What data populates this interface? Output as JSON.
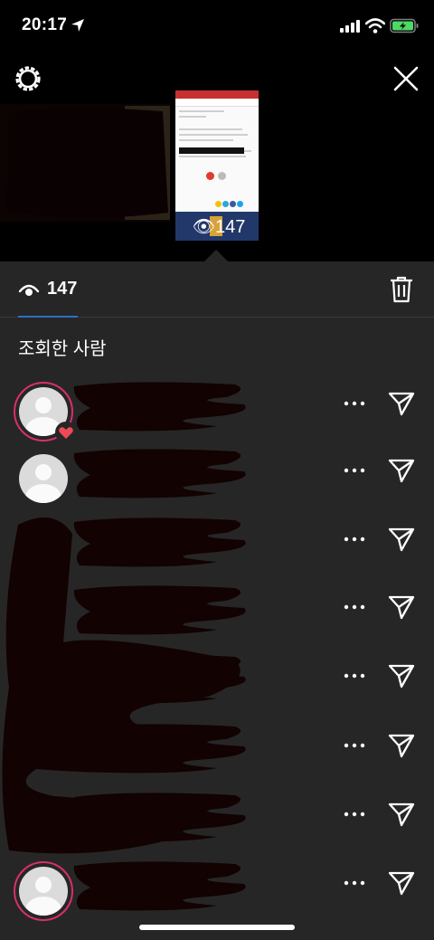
{
  "status_bar": {
    "time": "20:17"
  },
  "story": {
    "thumbnail_view_count": "147"
  },
  "viewers_panel": {
    "view_count": "147",
    "section_title": "조회한 사람"
  },
  "colors": {
    "background": "#262626",
    "top_background": "#000000",
    "accent_ring": "#d72f6d",
    "heart": "#ed4956",
    "tab_underline": "#2f6fbf"
  },
  "viewers": [
    {
      "avatar": "default",
      "story_ring": true,
      "liked": true
    },
    {
      "avatar": "default",
      "story_ring": false,
      "liked": false
    },
    {
      "avatar": "photo",
      "story_ring": false,
      "liked": false
    },
    {
      "avatar": "hidden",
      "story_ring": false,
      "liked": false
    },
    {
      "avatar": "hidden",
      "story_ring": false,
      "liked": false
    },
    {
      "avatar": "hidden",
      "story_ring": false,
      "liked": false
    },
    {
      "avatar": "hidden",
      "story_ring": false,
      "liked": false
    },
    {
      "avatar": "default",
      "story_ring": true,
      "liked": false
    }
  ],
  "icons": [
    "location-arrow-icon",
    "signal-icon",
    "wifi-icon",
    "battery-icon",
    "gear-icon",
    "close-icon",
    "eye-icon",
    "trash-icon",
    "more-dots-icon",
    "send-icon",
    "heart-icon"
  ]
}
